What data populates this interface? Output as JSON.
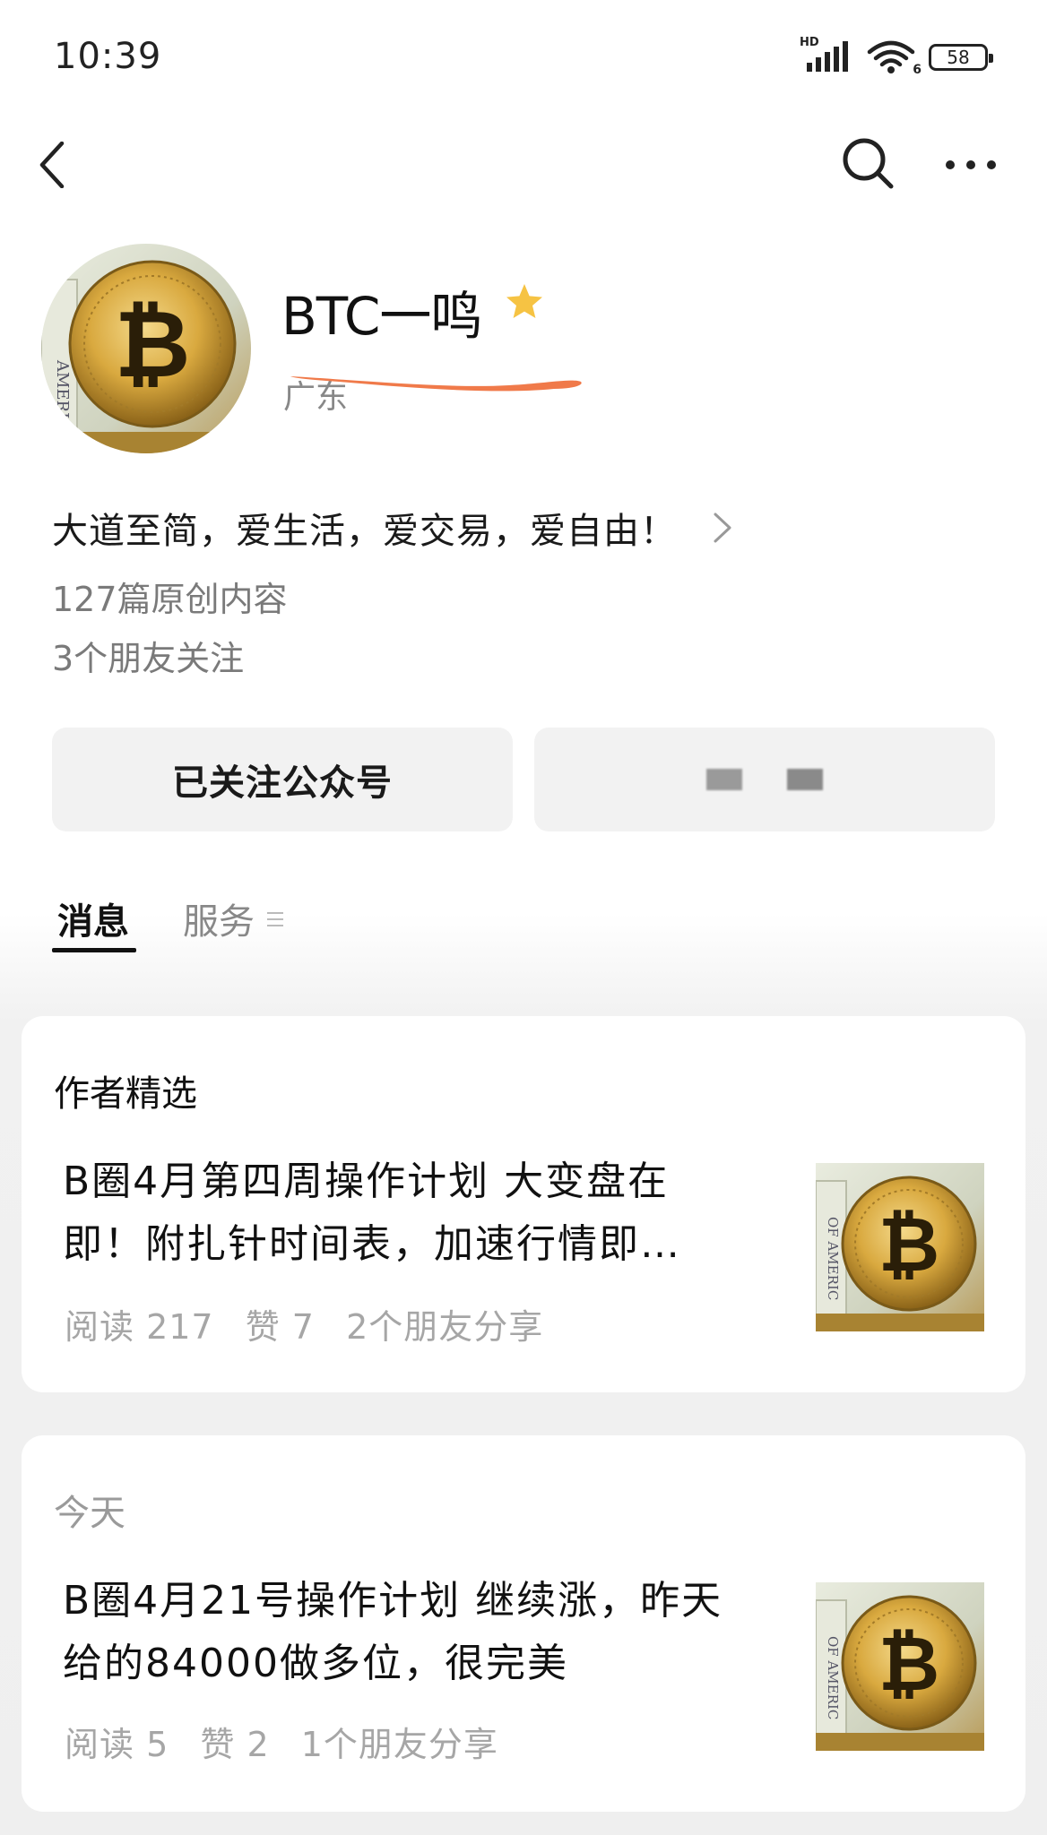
{
  "status_bar": {
    "time": "10:39",
    "network": "HD",
    "wifi": "6",
    "battery": "58"
  },
  "nav": {
    "back_icon": "chevron-left-icon",
    "search_icon": "search-icon",
    "more_icon": "more-icon"
  },
  "profile": {
    "name": "BTC一鸣",
    "region": "广东",
    "description": "大道至简，爱生活，爱交易，爱自由！",
    "original_count": "127篇原创内容",
    "friends_following": "3个朋友关注",
    "star_color": "#f6c343"
  },
  "actions": {
    "followed_label": "已关注公众号"
  },
  "tabs": [
    {
      "label": "消息"
    },
    {
      "label": "服务"
    }
  ],
  "sections": [
    {
      "heading": "作者精选",
      "article": {
        "title_line1": "B圈4月第四周操作计划 大变盘在",
        "title_line2": "即！附扎针时间表，加速行情即…",
        "reads": "阅读 217",
        "likes": "赞 7",
        "shares": "2个朋友分享"
      }
    },
    {
      "heading": "今天",
      "article": {
        "title_line1": "B圈4月21号操作计划 继续涨，昨天",
        "title_line2": "给的84000做多位，很完美",
        "reads": "阅读 5",
        "likes": "赞 2",
        "shares": "1个朋友分享"
      }
    }
  ]
}
